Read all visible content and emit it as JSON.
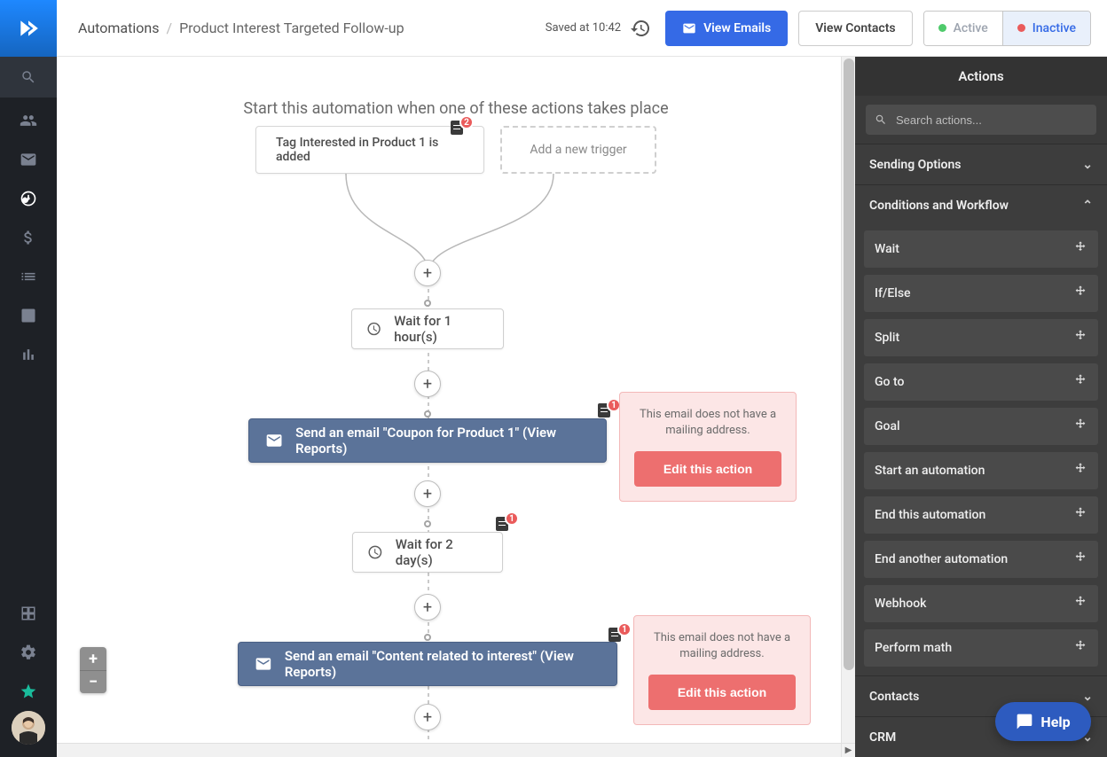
{
  "nav": {
    "icons": [
      "search",
      "contacts",
      "campaigns",
      "automations",
      "deals",
      "lists",
      "forms",
      "reports"
    ],
    "bottom_icons": [
      "apps",
      "settings",
      "star"
    ]
  },
  "header": {
    "breadcrumb_root": "Automations",
    "breadcrumb_current": "Product Interest Targeted Follow-up",
    "saved_label": "Saved at 10:42",
    "view_emails_label": "View Emails",
    "view_contacts_label": "View Contacts",
    "status_active_label": "Active",
    "status_inactive_label": "Inactive"
  },
  "flow": {
    "title": "Start this automation when one of these actions takes place",
    "trigger_1": "Tag Interested in Product 1 is added",
    "trigger_add": "Add a new trigger",
    "trigger_badge_count": "2",
    "wait_1": "Wait for 1 hour(s)",
    "wait_2": "Wait for 2 day(s)",
    "wait_2_badge": "1",
    "email_1": "Send an email \"Coupon for Product 1\" (View Reports)",
    "email_1_badge": "1",
    "email_2": "Send an email \"Content related to interest\" (View Reports)",
    "warning_msg": "This email does not have a mailing address.",
    "edit_action_label": "Edit this action"
  },
  "panel": {
    "title": "Actions",
    "search_placeholder": "Search actions...",
    "sections": {
      "sending": "Sending Options",
      "conditions": "Conditions and Workflow",
      "contacts": "Contacts",
      "crm": "CRM"
    },
    "condition_items": [
      "Wait",
      "If/Else",
      "Split",
      "Go to",
      "Goal",
      "Start an automation",
      "End this automation",
      "End another automation",
      "Webhook",
      "Perform math"
    ]
  },
  "help_label": "Help"
}
